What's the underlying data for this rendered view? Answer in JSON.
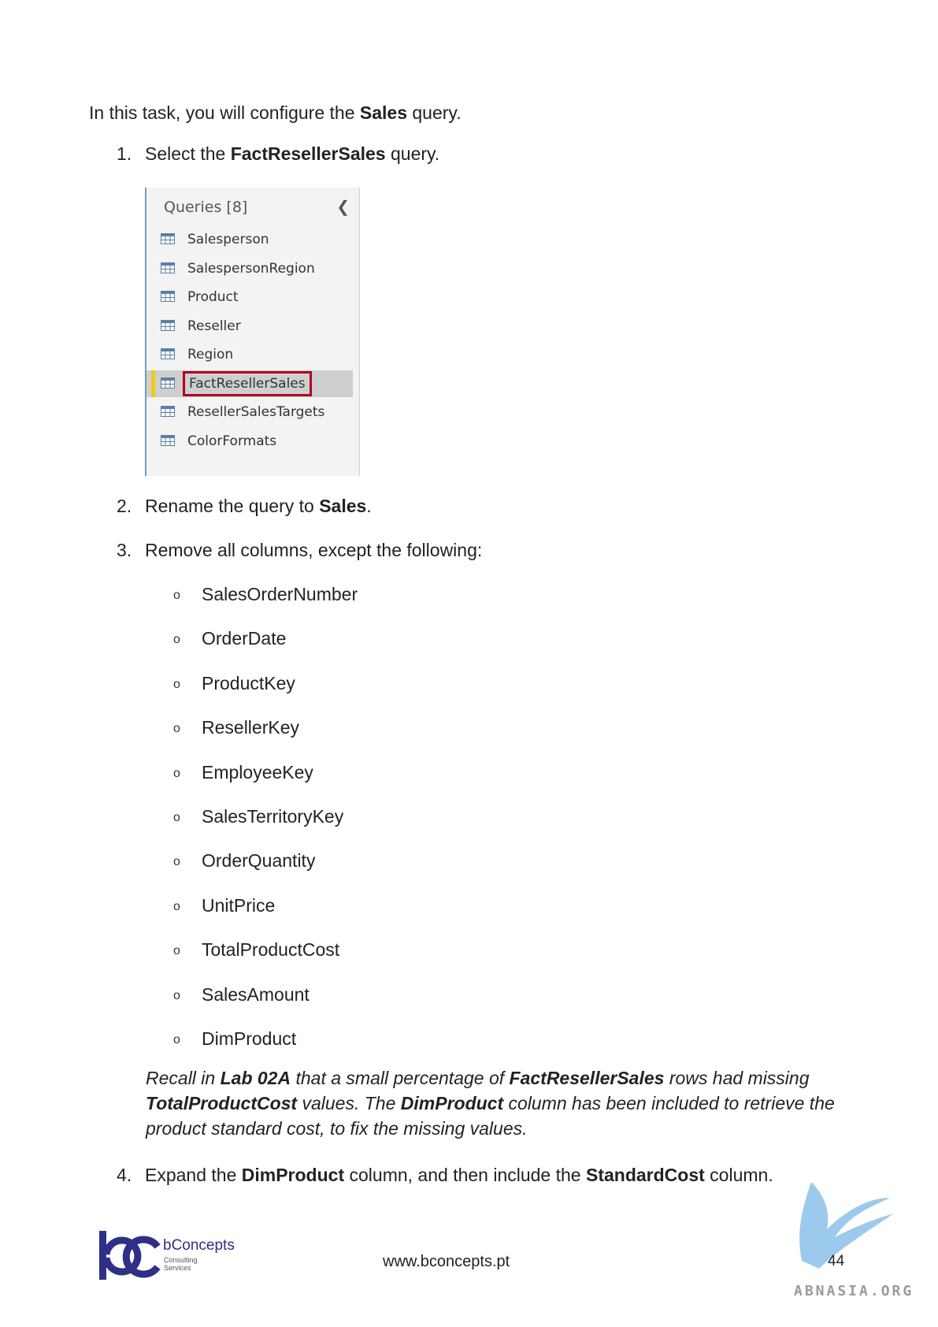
{
  "intro": {
    "pre": "In this task, you will configure the ",
    "bold": "Sales",
    "post": " query."
  },
  "steps": [
    {
      "num": "1.",
      "pre": "Select the ",
      "bold": "FactResellerSales",
      "post": " query."
    },
    {
      "num": "2.",
      "pre": "Rename the query to ",
      "bold": "Sales",
      "post": "."
    },
    {
      "num": "3.",
      "text": "Remove all columns, except the following:"
    },
    {
      "num": "4.",
      "pre": "Expand the ",
      "bold": "DimProduct",
      "mid": " column, and then include the ",
      "bold2": "StandardCost",
      "post": " column."
    }
  ],
  "queries_panel": {
    "header": "Queries [8]",
    "collapse_icon": "chevron-left-icon",
    "items": [
      "Salesperson",
      "SalespersonRegion",
      "Product",
      "Reseller",
      "Region",
      "FactResellerSales",
      "ResellerSalesTargets",
      "ColorFormats"
    ],
    "selected": "FactResellerSales",
    "highlight_color": "#b00020",
    "selection_bar_color": "#f2c811"
  },
  "bullet_glyph": "o",
  "columns": [
    "SalesOrderNumber",
    "OrderDate",
    "ProductKey",
    "ResellerKey",
    "EmployeeKey",
    "SalesTerritoryKey",
    "OrderQuantity",
    "UnitPrice",
    "TotalProductCost",
    "SalesAmount",
    "DimProduct"
  ],
  "note": {
    "t1": "Recall in ",
    "b1": "Lab 02A",
    "t2": " that a small percentage of ",
    "b2": "FactResellerSales",
    "t3": " rows had missing ",
    "b3": "TotalProductCost",
    "t4": " values. The ",
    "b4": "DimProduct",
    "t5": " column has been included to retrieve the product standard cost, to fix the missing values."
  },
  "footer": {
    "logo_name": "bConcepts",
    "logo_sub1": "Consulting",
    "logo_sub2": "Services",
    "url": "www.bconcepts.pt",
    "page": "44",
    "watermark": "ABNASIA.ORG"
  }
}
